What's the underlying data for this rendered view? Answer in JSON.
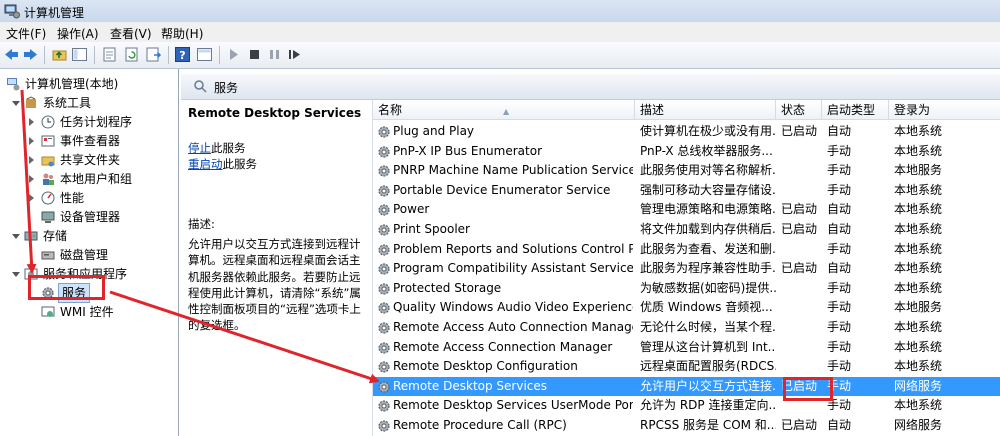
{
  "window": {
    "title": "计算机管理"
  },
  "menu": [
    "文件(F)",
    "操作(A)",
    "查看(V)",
    "帮助(H)"
  ],
  "tree": {
    "root": "计算机管理(本地)",
    "system_tools": "系统工具",
    "task_scheduler": "任务计划程序",
    "event_viewer": "事件查看器",
    "shared_folders": "共享文件夹",
    "local_users": "本地用户和组",
    "performance": "性能",
    "device_manager": "设备管理器",
    "storage": "存储",
    "disk_management": "磁盘管理",
    "services_apps": "服务和应用程序",
    "services": "服务",
    "wmi": "WMI 控件"
  },
  "panel": {
    "title": "服务"
  },
  "description": {
    "service_name": "Remote Desktop Services",
    "stop_link": "停止",
    "stop_rest": "此服务",
    "restart_link": "重启动",
    "restart_rest": "此服务",
    "desc_label": "描述:",
    "desc_text": "允许用户以交互方式连接到远程计算机。远程桌面和远程桌面会话主机服务器依赖此服务。若要防止远程使用此计算机，请清除“系统”属性控制面板项目的“远程”选项卡上的复选框。"
  },
  "columns": {
    "name": "名称",
    "desc": "描述",
    "status": "状态",
    "startup": "启动类型",
    "logon": "登录为"
  },
  "services": [
    {
      "name": "Plug and Play",
      "desc": "使计算机在极少或没有用...",
      "status": "已启动",
      "startup": "自动",
      "logon": "本地系统"
    },
    {
      "name": "PnP-X IP Bus Enumerator",
      "desc": "PnP-X 总线枚举器服务...",
      "status": "",
      "startup": "手动",
      "logon": "本地系统"
    },
    {
      "name": "PNRP Machine Name Publication Service",
      "desc": "此服务使用对等名称解析...",
      "status": "",
      "startup": "手动",
      "logon": "本地服务"
    },
    {
      "name": "Portable Device Enumerator Service",
      "desc": "强制可移动大容量存储设...",
      "status": "",
      "startup": "手动",
      "logon": "本地系统"
    },
    {
      "name": "Power",
      "desc": "管理电源策略和电源策略...",
      "status": "已启动",
      "startup": "自动",
      "logon": "本地系统"
    },
    {
      "name": "Print Spooler",
      "desc": "将文件加载到内存供稍后...",
      "status": "已启动",
      "startup": "自动",
      "logon": "本地系统"
    },
    {
      "name": "Problem Reports and Solutions Control Pa...",
      "desc": "此服务为查看、发送和删...",
      "status": "",
      "startup": "手动",
      "logon": "本地系统"
    },
    {
      "name": "Program Compatibility Assistant Service",
      "desc": "此服务为程序兼容性助手...",
      "status": "已启动",
      "startup": "自动",
      "logon": "本地系统"
    },
    {
      "name": "Protected Storage",
      "desc": "为敏感数据(如密码)提供...",
      "status": "",
      "startup": "手动",
      "logon": "本地系统"
    },
    {
      "name": "Quality Windows Audio Video Experience",
      "desc": "优质 Windows 音频视...",
      "status": "",
      "startup": "手动",
      "logon": "本地服务"
    },
    {
      "name": "Remote Access Auto Connection Manager",
      "desc": "无论什么时候，当某个程...",
      "status": "",
      "startup": "手动",
      "logon": "本地系统"
    },
    {
      "name": "Remote Access Connection Manager",
      "desc": "管理从这台计算机到 Int...",
      "status": "",
      "startup": "手动",
      "logon": "本地系统"
    },
    {
      "name": "Remote Desktop Configuration",
      "desc": "远程桌面配置服务(RDCS...",
      "status": "",
      "startup": "手动",
      "logon": "本地系统"
    },
    {
      "name": "Remote Desktop Services",
      "desc": "允许用户以交互方式连接...",
      "status": "已启动",
      "startup": "手动",
      "logon": "网络服务"
    },
    {
      "name": "Remote Desktop Services UserMode Port ...",
      "desc": "允许为 RDP 连接重定向...",
      "status": "",
      "startup": "手动",
      "logon": "本地系统"
    },
    {
      "name": "Remote Procedure Call (RPC)",
      "desc": "RPCSS 服务是 COM 和...",
      "status": "已启动",
      "startup": "自动",
      "logon": "网络服务"
    }
  ],
  "selected_index": 13,
  "colors": {
    "selection": "#3399ff",
    "annotation": "#e0242a",
    "link": "#0645ad"
  }
}
